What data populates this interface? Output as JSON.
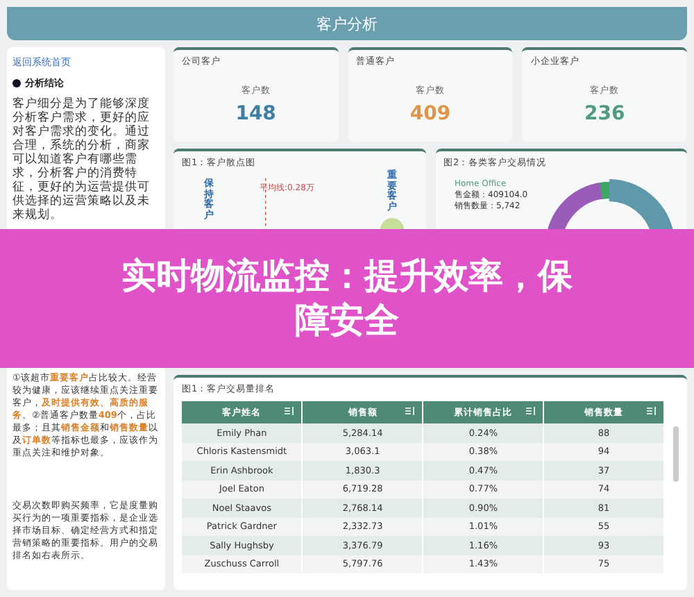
{
  "header": {
    "title": "客户分析"
  },
  "sidebar": {
    "back_link": "返回系统首页",
    "section_title": "分析结论",
    "intro": "客户细分是为了能够深度分析客户需求，更好的应对客户需求的变化。通过合理，系统的分析，商家可以知道客户有哪些需求，分析客户的消费特征，更好的为运营提供可供选择的运营策略以及未来规划。",
    "notes": "①该超市**重要客户**占比较大。经营较为健康，应该继续重点关注重要客户，**及时提供有效、高质的服务**。②普通客户数量**409**个，占比最多；且其**销售金额**和**销售数量**以及**订单数**等指标也最多，应该作为重点关注和维护对象。",
    "footer": "交易次数即购买频率，它是度量购买行为的一项重要指标，是企业选择市场目标、确定经营方式和指定营销策略的重要指标。用户的交易排名如右表所示。"
  },
  "kpis": [
    {
      "title": "公司客户",
      "label": "客户数",
      "value": "148",
      "color": "#3f7fa6"
    },
    {
      "title": "普通客户",
      "label": "客户数",
      "value": "409",
      "color": "#e0954a"
    },
    {
      "title": "小企业客户",
      "label": "客户数",
      "value": "236",
      "color": "#4f9a80"
    }
  ],
  "scatter": {
    "title": "图1：客户散点图",
    "average_label": "平均线:0.28万",
    "quadrants": [
      "保持客户",
      "重要客户"
    ]
  },
  "donut": {
    "title": "图2：各类客户交易情况",
    "segment_name": "Home Office",
    "segment_lines": [
      "售金额：409104.0",
      "销售数量：5,742"
    ]
  },
  "ranking": {
    "title": "图1：客户交易量排名",
    "columns": [
      "客户姓名",
      "销售额",
      "累计销售占比",
      "销售数量"
    ],
    "rows": [
      [
        "Emily Phan",
        "5,284.14",
        "0.24%",
        "88"
      ],
      [
        "Chloris Kastensmidt",
        "3,063.1",
        "0.38%",
        "94"
      ],
      [
        "Erin Ashbrook",
        "1,830.3",
        "0.47%",
        "37"
      ],
      [
        "Joel Eaton",
        "6,719.28",
        "0.77%",
        "74"
      ],
      [
        "Noel Staavos",
        "2,768.14",
        "0.90%",
        "81"
      ],
      [
        "Patrick Gardner",
        "2,332.73",
        "1.01%",
        "55"
      ],
      [
        "Sally Hughsby",
        "3,376.79",
        "1.16%",
        "93"
      ],
      [
        "Zuschuss Carroll",
        "5,797.76",
        "1.43%",
        "75"
      ]
    ]
  },
  "banner": {
    "text": "实时物流监控：提升效率，保障安全"
  }
}
